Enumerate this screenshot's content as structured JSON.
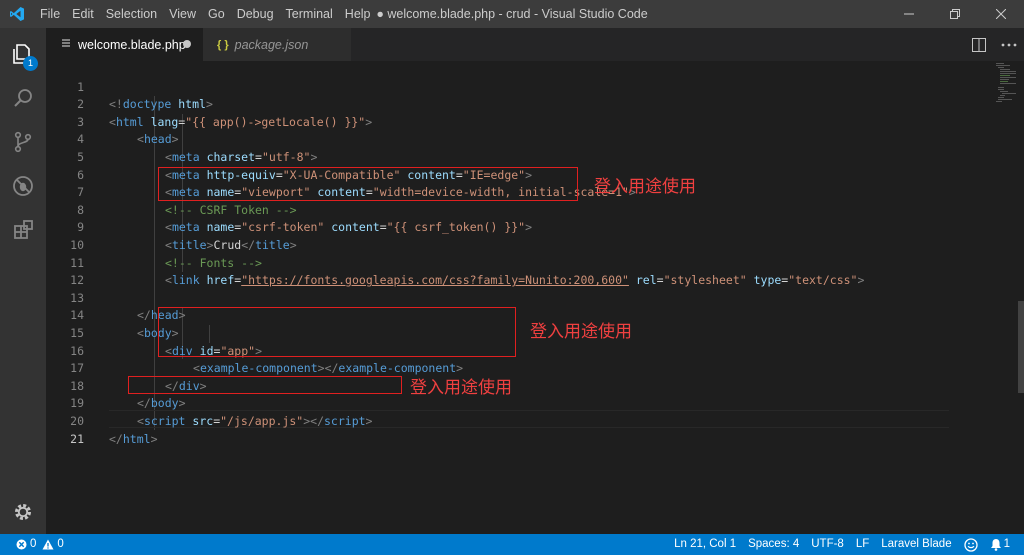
{
  "window": {
    "title": "● welcome.blade.php - crud - Visual Studio Code",
    "menu": [
      "File",
      "Edit",
      "Selection",
      "View",
      "Go",
      "Debug",
      "Terminal",
      "Help"
    ]
  },
  "activity": {
    "explorer_badge": "1",
    "items": [
      "explorer-icon",
      "search-icon",
      "source-control-icon",
      "debug-icon",
      "extensions-icon"
    ],
    "bottom": "gear-icon"
  },
  "tabs": [
    {
      "label": "welcome.blade.php",
      "icon": "php-file-icon",
      "dirty": true,
      "active": true
    },
    {
      "label": "package.json",
      "icon": "{ }",
      "dirty": false,
      "active": false
    }
  ],
  "editor": {
    "current_line": 21,
    "lines": [
      {
        "n": "1"
      },
      {
        "n": "2"
      },
      {
        "n": "3"
      },
      {
        "n": "4"
      },
      {
        "n": "5"
      },
      {
        "n": "6"
      },
      {
        "n": "7"
      },
      {
        "n": "8"
      },
      {
        "n": "9"
      },
      {
        "n": "10"
      },
      {
        "n": "11"
      },
      {
        "n": "12"
      },
      {
        "n": "13"
      },
      {
        "n": "14"
      },
      {
        "n": "15"
      },
      {
        "n": "16"
      },
      {
        "n": "17"
      },
      {
        "n": "18"
      },
      {
        "n": "19"
      },
      {
        "n": "20"
      },
      {
        "n": "21"
      }
    ],
    "annotations": [
      {
        "label": "登入用途使用"
      },
      {
        "label": "登入用途使用"
      },
      {
        "label": "登入用途使用"
      }
    ]
  },
  "code": {
    "l1": {
      "a": "<!",
      "b": "doctype",
      "c": " html",
      "d": ">"
    },
    "l2": {
      "a": "<",
      "b": "html",
      "c": " lang",
      "d": "=",
      "e": "\"{{ app()->getLocale() }}\"",
      "f": ">"
    },
    "l3": {
      "a": "<",
      "b": "head",
      "c": ">"
    },
    "l4": {
      "a": "<",
      "b": "meta",
      "c": " charset",
      "d": "=",
      "e": "\"utf-8\"",
      "f": ">"
    },
    "l5": {
      "a": "<",
      "b": "meta",
      "c": " http-equiv",
      "d": "=",
      "e": "\"X-UA-Compatible\"",
      "f": " content",
      "g": "=",
      "h": "\"IE=edge\"",
      "i": ">"
    },
    "l6": {
      "a": "<",
      "b": "meta",
      "c": " name",
      "d": "=",
      "e": "\"viewport\"",
      "f": " content",
      "g": "=",
      "h": "\"width=device-width, initial-scale=1\"",
      "i": ">"
    },
    "l7": {
      "a": "<!-- CSRF Token -->"
    },
    "l8": {
      "a": "<",
      "b": "meta",
      "c": " name",
      "d": "=",
      "e": "\"csrf-token\"",
      "f": " content",
      "g": "=",
      "h": "\"{{ csrf_token() }}\"",
      "i": ">"
    },
    "l9": {
      "a": "<",
      "b": "title",
      "c": ">",
      "d": "Crud",
      "e": "</",
      "f": "title",
      "g": ">"
    },
    "l10": {
      "a": "<!-- Fonts -->"
    },
    "l11": {
      "a": "<",
      "b": "link",
      "c": " href",
      "d": "=",
      "e": "\"https://fonts.googleapis.com/css?family=Nunito:200,600\"",
      "f": " rel",
      "g": "=",
      "h": "\"stylesheet\"",
      "i": " type",
      "j": "=",
      "k": "\"text/css\"",
      "l": ">"
    },
    "l13": {
      "a": "</",
      "b": "head",
      "c": ">"
    },
    "l14": {
      "a": "<",
      "b": "body",
      "c": ">"
    },
    "l15": {
      "a": "<",
      "b": "div",
      "c": " id",
      "d": "=",
      "e": "\"app\"",
      "f": ">"
    },
    "l16": {
      "a": "<",
      "b": "example-component",
      "c": "></",
      "d": "example-component",
      "e": ">"
    },
    "l17": {
      "a": "</",
      "b": "div",
      "c": ">"
    },
    "l18": {
      "a": "</",
      "b": "body",
      "c": ">"
    },
    "l19": {
      "a": "<",
      "b": "script",
      "c": " src",
      "d": "=",
      "e": "\"/js/app.js\"",
      "f": "></",
      "g": "script",
      "h": ">"
    },
    "l20": {
      "a": "</",
      "b": "html",
      "c": ">"
    }
  },
  "status": {
    "errors": "0",
    "warnings": "0",
    "position": "Ln 21, Col 1",
    "spaces": "Spaces: 4",
    "encoding": "UTF-8",
    "eol": "LF",
    "language": "Laravel Blade"
  },
  "colors": {
    "accent": "#007acc",
    "annotation": "#e02020"
  }
}
